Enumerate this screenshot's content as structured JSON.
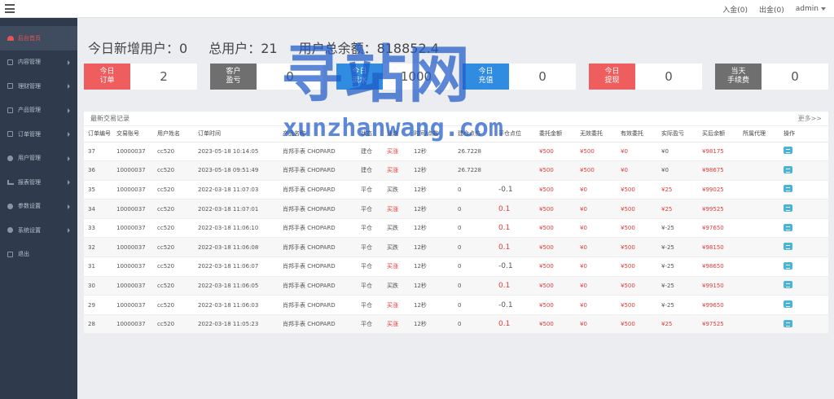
{
  "topbar": {
    "links": [
      {
        "label": "入金(0)"
      },
      {
        "label": "出金(0)"
      }
    ],
    "user": "admin"
  },
  "sidebar": {
    "items": [
      {
        "label": "后台首页",
        "icon": "dashboard-icon",
        "active": true
      },
      {
        "label": "内容管理",
        "icon": "content-icon"
      },
      {
        "label": "理财管理",
        "icon": "finance-icon"
      },
      {
        "label": "产品管理",
        "icon": "product-icon"
      },
      {
        "label": "订单管理",
        "icon": "order-icon"
      },
      {
        "label": "用户管理",
        "icon": "user-icon"
      },
      {
        "label": "报表管理",
        "icon": "report-icon"
      },
      {
        "label": "参数设置",
        "icon": "settings-icon"
      },
      {
        "label": "系统设置",
        "icon": "gear-icon"
      },
      {
        "label": "退出",
        "icon": "logout-icon"
      }
    ]
  },
  "stats": {
    "new_users": "今日新增用户：0",
    "total_users": "总用户：21",
    "total_balance": "用户总余额：818852.4"
  },
  "cards": [
    {
      "label1": "今日",
      "label2": "订单",
      "value": "2",
      "color": "#ee5e5e"
    },
    {
      "label1": "客户",
      "label2": "盈亏",
      "value": "0",
      "color": "#6f6f6f"
    },
    {
      "label1": "今日",
      "label2": "流水",
      "value": "1000",
      "color": "#2f8ce0"
    },
    {
      "label1": "今日",
      "label2": "充值",
      "value": "0",
      "color": "#2f8ce0"
    },
    {
      "label1": "今日",
      "label2": "提现",
      "value": "0",
      "color": "#ee5e5e"
    },
    {
      "label1": "当天",
      "label2": "手续费",
      "value": "0",
      "color": "#6f6f6f"
    }
  ],
  "table": {
    "title": "最新交易记录",
    "more": "更多>>",
    "headers": [
      "订单编号",
      "交易账号",
      "用户姓名",
      "订单时间",
      "产品名称",
      "状态",
      "涨跌",
      "时间/点数",
      "建仓点位",
      "平仓点位",
      "委托金额",
      "无效委托",
      "有效委托",
      "实际盈亏",
      "买后余额",
      "所属代理",
      "操作"
    ],
    "rows": [
      [
        "37",
        "10000037",
        "cc520",
        "2023-05-18 10:14:05",
        "肖邦手表 CHOPARD",
        "建仓",
        "买涨",
        "12秒",
        "26.7228",
        "",
        "¥500",
        "¥500",
        "¥0",
        "¥0",
        "¥98175",
        ""
      ],
      [
        "36",
        "10000037",
        "cc520",
        "2023-05-18 09:51:49",
        "肖邦手表 CHOPARD",
        "建仓",
        "买涨",
        "12秒",
        "26.7228",
        "",
        "¥500",
        "¥500",
        "¥0",
        "¥0",
        "¥98675",
        ""
      ],
      [
        "35",
        "10000037",
        "cc520",
        "2022-03-18 11:07:03",
        "肖邦手表 CHOPARD",
        "平仓",
        "买跌",
        "12秒",
        "0",
        "-0.1",
        "¥500",
        "¥0",
        "¥500",
        "¥25",
        "¥99025",
        ""
      ],
      [
        "34",
        "10000037",
        "cc520",
        "2022-03-18 11:07:01",
        "肖邦手表 CHOPARD",
        "平仓",
        "买涨",
        "12秒",
        "0",
        "0.1",
        "¥500",
        "¥0",
        "¥500",
        "¥25",
        "¥99525",
        ""
      ],
      [
        "33",
        "10000037",
        "cc520",
        "2022-03-18 11:06:10",
        "肖邦手表 CHOPARD",
        "平仓",
        "买跌",
        "12秒",
        "0",
        "0.1",
        "¥500",
        "¥0",
        "¥500",
        "¥-25",
        "¥97650",
        ""
      ],
      [
        "32",
        "10000037",
        "cc520",
        "2022-03-18 11:06:08",
        "肖邦手表 CHOPARD",
        "平仓",
        "买跌",
        "12秒",
        "0",
        "0.1",
        "¥500",
        "¥0",
        "¥500",
        "¥-25",
        "¥98150",
        ""
      ],
      [
        "31",
        "10000037",
        "cc520",
        "2022-03-18 11:06:07",
        "肖邦手表 CHOPARD",
        "平仓",
        "买涨",
        "12秒",
        "0",
        "-0.1",
        "¥500",
        "¥0",
        "¥500",
        "¥-25",
        "¥98650",
        ""
      ],
      [
        "30",
        "10000037",
        "cc520",
        "2022-03-18 11:06:05",
        "肖邦手表 CHOPARD",
        "平仓",
        "买跌",
        "12秒",
        "0",
        "0.1",
        "¥500",
        "¥0",
        "¥500",
        "¥-25",
        "¥99150",
        ""
      ],
      [
        "29",
        "10000037",
        "cc520",
        "2022-03-18 11:06:03",
        "肖邦手表 CHOPARD",
        "平仓",
        "买涨",
        "12秒",
        "0",
        "-0.1",
        "¥500",
        "¥0",
        "¥500",
        "¥-25",
        "¥99650",
        ""
      ],
      [
        "28",
        "10000037",
        "cc520",
        "2022-03-18 11:05:23",
        "肖邦手表 CHOPARD",
        "平仓",
        "买涨",
        "12秒",
        "0",
        "0.1",
        "¥500",
        "¥0",
        "¥500",
        "¥25",
        "¥97525",
        ""
      ]
    ]
  },
  "watermark": {
    "main": "寻站网",
    "sub": "xunzhanwang.com"
  }
}
